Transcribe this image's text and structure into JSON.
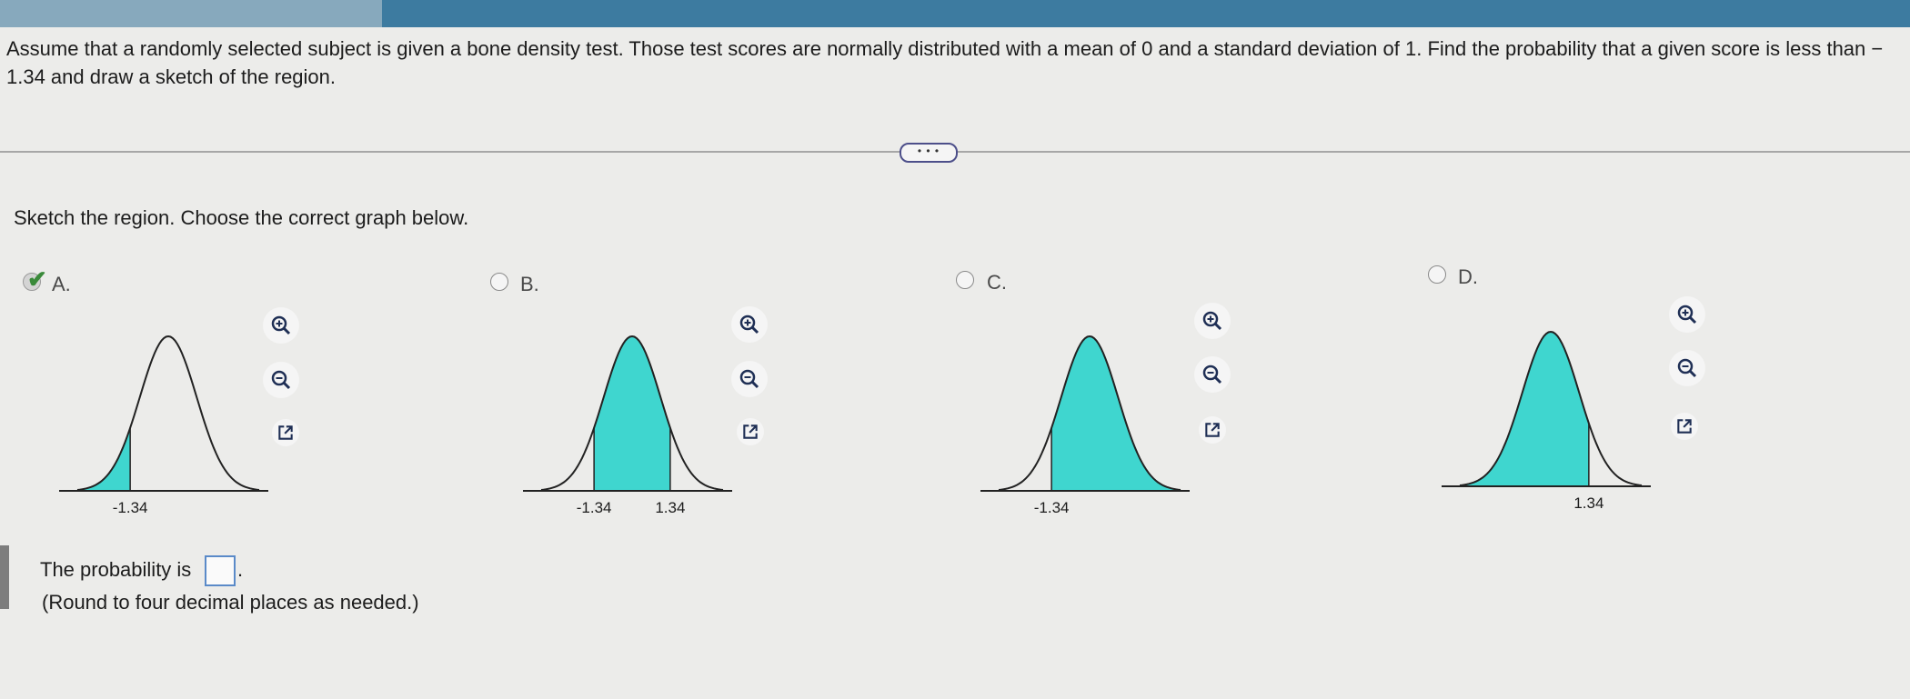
{
  "question": {
    "text": "Assume that a randomly selected subject is given a bone density test. Those test scores are normally distributed with a mean of 0 and a standard deviation of 1. Find the probability that a given score is less than  − 1.34 and draw a sketch of the region."
  },
  "more_button": "• • •",
  "instruction": "Sketch the region. Choose the correct graph below.",
  "options": [
    {
      "label": "A.",
      "checked": true,
      "shade": "left",
      "ticks": [
        "-1.34"
      ]
    },
    {
      "label": "B.",
      "checked": false,
      "shade": "between",
      "ticks": [
        "-1.34",
        "1.34"
      ]
    },
    {
      "label": "C.",
      "checked": false,
      "shade": "right",
      "ticks": [
        "-1.34"
      ]
    },
    {
      "label": "D.",
      "checked": false,
      "shade": "left",
      "ticks": [
        "1.34"
      ]
    }
  ],
  "icons": [
    "zoom-in-icon",
    "zoom-out-icon",
    "pop-out-icon"
  ],
  "answer": {
    "label": "The probability is",
    "value": "",
    "period": ".",
    "hint": "(Round to four decimal places as needed.)"
  },
  "colors": {
    "shade": "#3fd6cf",
    "checkmark": "#3a8a3a",
    "bar": "#3d7ba0"
  }
}
